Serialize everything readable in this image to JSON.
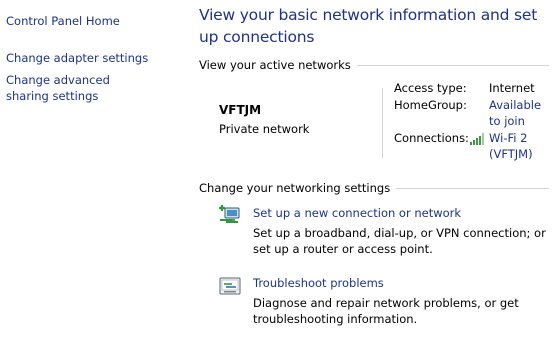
{
  "sidebar": {
    "home": "Control Panel Home",
    "adapter": "Change adapter settings",
    "sharing": "Change advanced sharing settings"
  },
  "main": {
    "title": "View your basic network information and set up connections",
    "active_networks_heading": "View your active networks",
    "network": {
      "name": "VFTJM",
      "type": "Private network",
      "access_type_label": "Access type:",
      "access_type_value": "Internet",
      "homegroup_label": "HomeGroup:",
      "homegroup_value": "Available to join",
      "connections_label": "Connections:",
      "connections_value": "Wi-Fi 2 (VFTJM)"
    },
    "settings_heading": "Change your networking settings",
    "tasks": [
      {
        "icon": "new-connection-icon",
        "link": "Set up a new connection or network",
        "desc": "Set up a broadband, dial-up, or VPN connection; or set up a router or access point."
      },
      {
        "icon": "troubleshoot-icon",
        "link": "Troubleshoot problems",
        "desc": "Diagnose and repair network problems, or get troubleshooting information."
      }
    ]
  },
  "colors": {
    "link": "#1e3287",
    "rule": "#d5d5d5",
    "signal": "#3c9a3c"
  }
}
